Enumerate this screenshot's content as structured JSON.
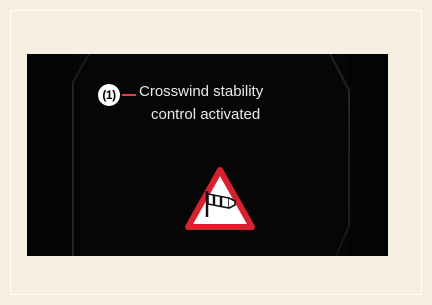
{
  "display": {
    "callout_number": "(1)",
    "message_line1": "Crosswind stability",
    "message_line2": "control activated"
  },
  "icons": {
    "warning": "crosswind-warning-icon"
  },
  "colors": {
    "background": "#f6efe2",
    "display": "#040404",
    "callout_line": "#e83a4a",
    "warning_border": "#d8202e"
  }
}
